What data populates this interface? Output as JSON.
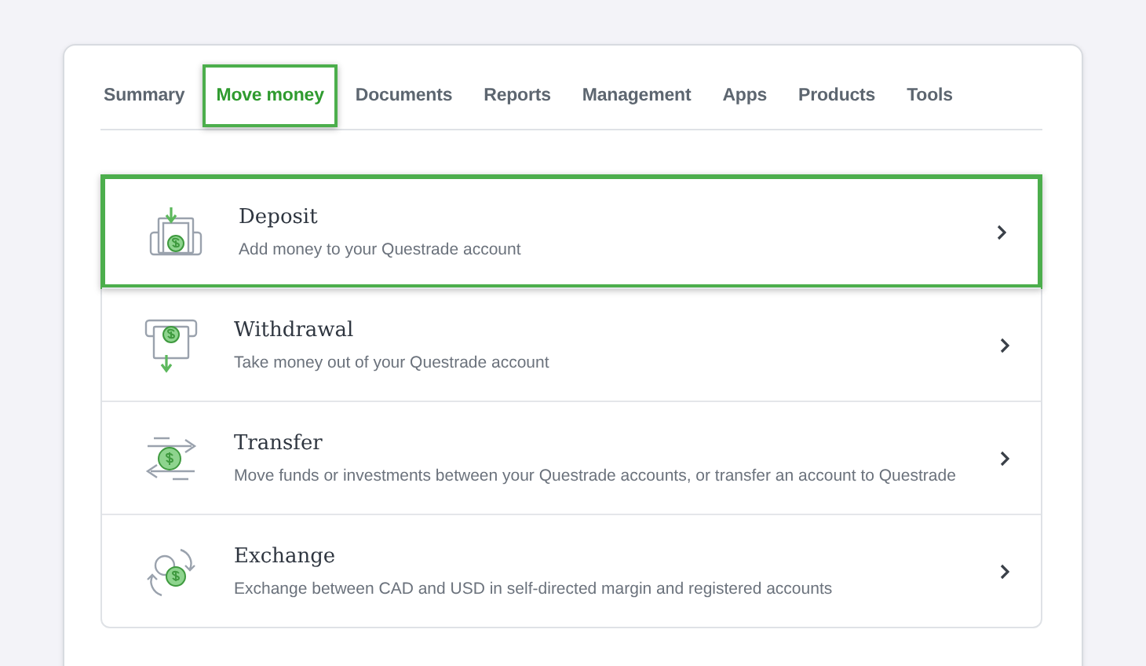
{
  "tabs": [
    {
      "label": "Summary",
      "selected": false
    },
    {
      "label": "Move money",
      "selected": true
    },
    {
      "label": "Documents",
      "selected": false
    },
    {
      "label": "Reports",
      "selected": false
    },
    {
      "label": "Management",
      "selected": false
    },
    {
      "label": "Apps",
      "selected": false
    },
    {
      "label": "Products",
      "selected": false
    },
    {
      "label": "Tools",
      "selected": false
    }
  ],
  "actions": [
    {
      "kind": "deposit",
      "title": "Deposit",
      "description": "Add money to your Questrade account",
      "selected": true
    },
    {
      "kind": "withdrawal",
      "title": "Withdrawal",
      "description": "Take money out of your Questrade account",
      "selected": false
    },
    {
      "kind": "transfer",
      "title": "Transfer",
      "description": "Move funds or investments between your Questrade accounts, or transfer an account to Questrade",
      "selected": false
    },
    {
      "kind": "exchange",
      "title": "Exchange",
      "description": "Exchange between CAD and USD in self-directed margin and registered accounts",
      "selected": false
    }
  ]
}
